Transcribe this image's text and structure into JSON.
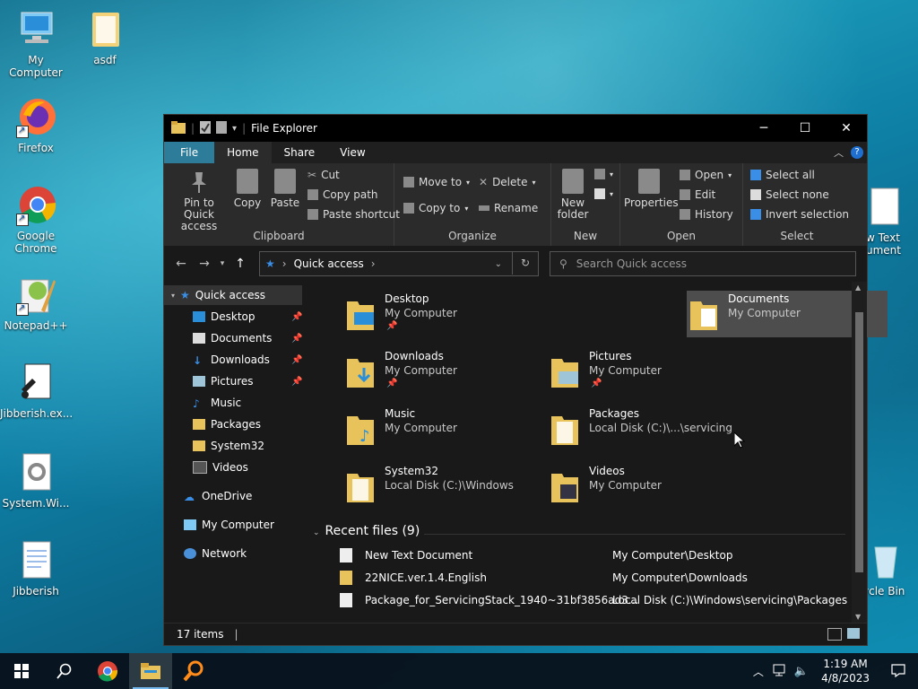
{
  "desktop": {
    "icons": [
      {
        "label": "My Computer"
      },
      {
        "label": "asdf"
      },
      {
        "label": "Firefox"
      },
      {
        "label": "Google Chrome"
      },
      {
        "label": "Notepad++"
      },
      {
        "label": "Jibberish.ex..."
      },
      {
        "label": "System.Wi..."
      },
      {
        "label": "Jibberish"
      },
      {
        "label": "w Text\nument"
      },
      {
        "label": "ycle Bin"
      }
    ]
  },
  "window": {
    "title": "File Explorer",
    "tabs": [
      "File",
      "Home",
      "Share",
      "View"
    ],
    "ribbon": {
      "clipboard": {
        "label": "Clipboard",
        "pin": "Pin to Quick access",
        "copy": "Copy",
        "paste": "Paste",
        "cut": "Cut",
        "copy_path": "Copy path",
        "paste_shortcut": "Paste shortcut"
      },
      "organize": {
        "label": "Organize",
        "move_to": "Move to",
        "copy_to": "Copy to",
        "delete": "Delete",
        "rename": "Rename"
      },
      "new": {
        "label": "New",
        "new_folder": "New folder"
      },
      "open": {
        "label": "Open",
        "properties": "Properties",
        "open": "Open",
        "edit": "Edit",
        "history": "History"
      },
      "select": {
        "label": "Select",
        "select_all": "Select all",
        "select_none": "Select none",
        "invert": "Invert selection"
      }
    },
    "address": {
      "location": "Quick access",
      "search_placeholder": "Search Quick access"
    },
    "nav": {
      "quick_access": "Quick access",
      "items": [
        "Desktop",
        "Documents",
        "Downloads",
        "Pictures",
        "Music",
        "Packages",
        "System32",
        "Videos"
      ],
      "onedrive": "OneDrive",
      "my_computer": "My Computer",
      "network": "Network"
    },
    "folders": [
      {
        "name": "Desktop",
        "sub": "My Computer"
      },
      {
        "name": "Documents",
        "sub": "My Computer"
      },
      {
        "name": "Downloads",
        "sub": "My Computer"
      },
      {
        "name": "Pictures",
        "sub": "My Computer"
      },
      {
        "name": "Music",
        "sub": "My Computer"
      },
      {
        "name": "Packages",
        "sub": "Local Disk (C:)\\...\\servicing"
      },
      {
        "name": "System32",
        "sub": "Local Disk (C:)\\Windows"
      },
      {
        "name": "Videos",
        "sub": "My Computer"
      }
    ],
    "recent": {
      "header": "Recent files (9)",
      "files": [
        {
          "name": "New Text Document",
          "path": "My Computer\\Desktop"
        },
        {
          "name": "22NICE.ver.1.4.English",
          "path": "My Computer\\Downloads"
        },
        {
          "name": "Package_for_ServicingStack_1940~31bf3856ad3...",
          "path": "Local Disk (C:)\\Windows\\servicing\\Packages"
        }
      ]
    },
    "status": {
      "items": "17 items"
    }
  },
  "taskbar": {
    "time": "1:19 AM",
    "date": "4/8/2023"
  },
  "colors": {
    "folder": "#e8c25a",
    "accent": "#2d7d9a",
    "selected": "#4d4d4d"
  }
}
